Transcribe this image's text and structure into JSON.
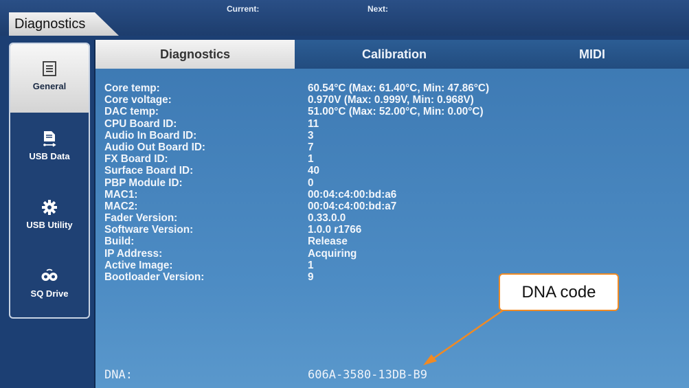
{
  "header": {
    "title": "Diagnostics",
    "current_label": "Current:",
    "next_label": "Next:"
  },
  "sidebar": {
    "items": [
      {
        "label": "General",
        "icon": "list-icon",
        "active": true
      },
      {
        "label": "USB Data",
        "icon": "usb-file-icon",
        "active": false
      },
      {
        "label": "USB Utility",
        "icon": "gear-icon",
        "active": false
      },
      {
        "label": "SQ Drive",
        "icon": "tape-reels-icon",
        "active": false
      }
    ]
  },
  "tabs": [
    {
      "label": "Diagnostics",
      "active": true
    },
    {
      "label": "Calibration",
      "active": false
    },
    {
      "label": "MIDI",
      "active": false
    }
  ],
  "diagnostics": [
    {
      "label": "Core temp:",
      "value": "60.54°C  (Max: 61.40°C, Min: 47.86°C)"
    },
    {
      "label": "Core voltage:",
      "value": "0.970V  (Max: 0.999V,  Min:  0.968V)"
    },
    {
      "label": "DAC temp:",
      "value": "51.00°C  (Max: 52.00°C, Min: 0.00°C)"
    },
    {
      "label": "CPU Board ID:",
      "value": "11"
    },
    {
      "label": "Audio In Board ID:",
      "value": "3"
    },
    {
      "label": "Audio Out Board ID:",
      "value": "7"
    },
    {
      "label": "FX Board ID:",
      "value": "1"
    },
    {
      "label": "Surface Board ID:",
      "value": "40"
    },
    {
      "label": "PBP Module ID:",
      "value": "0"
    },
    {
      "label": "MAC1:",
      "value": "00:04:c4:00:bd:a6"
    },
    {
      "label": "MAC2:",
      "value": "00:04:c4:00:bd:a7"
    },
    {
      "label": "Fader Version:",
      "value": "0.33.0.0"
    },
    {
      "label": "Software Version:",
      "value": "1.0.0 r1766"
    },
    {
      "label": "Build:",
      "value": "Release"
    },
    {
      "label": "IP Address:",
      "value": "Acquiring"
    },
    {
      "label": "Active Image:",
      "value": "1"
    },
    {
      "label": "Bootloader Version:",
      "value": "9"
    }
  ],
  "dna": {
    "label": "DNA:",
    "value": "606A-3580-13DB-B9"
  },
  "annotation": {
    "text": "DNA code",
    "color": "#f08a24"
  },
  "colors": {
    "background": "#1c3f73",
    "panel": "#4d8cc4",
    "accent": "#f08a24"
  }
}
